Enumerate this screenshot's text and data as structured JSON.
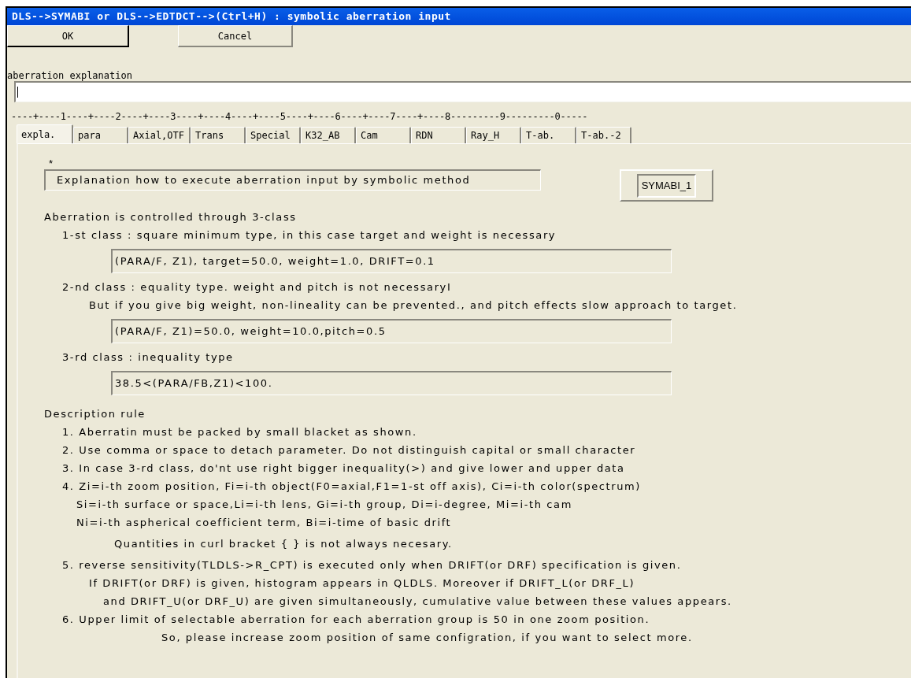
{
  "window": {
    "title": "DLS-->SYMABI or DLS-->EDTDCT-->(Ctrl+H) : symbolic aberration input"
  },
  "buttons": [
    {
      "label": "OK",
      "default": true
    },
    {
      "label": "Cancel",
      "default": false
    }
  ],
  "explanation_field": {
    "label": "aberration explanation",
    "focused": true
  },
  "ruler": "----+----1----+----2----+----3----+----4----+----5----+----6----+----7----+----8---------9---------0-----",
  "tabs": [
    {
      "label": "expla.",
      "selected": true
    },
    {
      "label": "para",
      "selected": false
    },
    {
      "label": "Axial,OTF",
      "selected": false
    },
    {
      "label": "Trans",
      "selected": false
    },
    {
      "label": "Special",
      "selected": false
    },
    {
      "label": "K32_AB",
      "selected": false
    },
    {
      "label": "Cam",
      "selected": false
    },
    {
      "label": "RDN",
      "selected": false
    },
    {
      "label": "Ray_H",
      "selected": false
    },
    {
      "label": "T-ab.",
      "selected": false
    },
    {
      "label": "T-ab.-2",
      "selected": false
    }
  ],
  "panel": {
    "marker": "*",
    "heading": "Explanation how to execute aberration input by symbolic method",
    "code_button": "SYMABI_1",
    "lines": [
      {
        "kind": "heading",
        "text": "Aberration is controlled through 3-class"
      },
      {
        "kind": "item",
        "text": "1-st class : square minimum type, in this case target and weight is necessary"
      },
      {
        "kind": "field",
        "text": "(PARA/F, Z1), target=50.0, weight=1.0, DRIFT=0.1"
      },
      {
        "kind": "item",
        "text": "2-nd class : equality type. weight and pitch is not necessaryI"
      },
      {
        "kind": "detail",
        "text": "But if you give big weight, non-lineality can be prevented., and pitch effects slow approach to target."
      },
      {
        "kind": "field",
        "text": "(PARA/F, Z1)=50.0, weight=10.0,pitch=0.5"
      },
      {
        "kind": "item",
        "text": "3-rd class : inequality type"
      },
      {
        "kind": "field",
        "text": "38.5<(PARA/FB,Z1)<100."
      },
      {
        "kind": "heading",
        "text": "Description rule"
      },
      {
        "kind": "item",
        "text": "1. Aberratin must be packed by small blacket as shown."
      },
      {
        "kind": "item",
        "text": "2. Use comma or space to detach parameter. Do not distinguish capital or small character"
      },
      {
        "kind": "item",
        "text": "3. In case 3-rd class, do'nt use right bigger inequality(>) and give lower and upper data"
      },
      {
        "kind": "item",
        "text": "4. Zi=i-th zoom position, Fi=i-th object(F0=axial,F1=1-st off axis), Ci=i-th color(spectrum)"
      },
      {
        "kind": "subitem",
        "text": "Si=i-th surface or space,Li=i-th lens, Gi=i-th group, Di=i-degree, Mi=i-th cam"
      },
      {
        "kind": "subitem",
        "text": "Ni=i-th aspherical coefficient term, Bi=i-time of basic drift"
      },
      {
        "kind": "note",
        "text": "Quantities in curl bracket { } is not always necesary."
      },
      {
        "kind": "item",
        "text": "5. reverse sensitivity(TLDLS->R_CPT) is executed only when DRIFT(or DRF) specification is given."
      },
      {
        "kind": "detail",
        "text": "If DRIFT(or DRF) is given, histogram appears in QLDLS. Moreover if DRIFT_L(or DRF_L)"
      },
      {
        "kind": "subdetail",
        "text": "and DRIFT_U(or DRF_U) are given simultaneously, cumulative value between these values appears."
      },
      {
        "kind": "item",
        "text": "6. Upper limit of selectable aberration for each aberration group is 50 in one zoom position."
      },
      {
        "kind": "aside",
        "text": "So, please increase zoom position of same configration, if you want to select more."
      }
    ]
  }
}
